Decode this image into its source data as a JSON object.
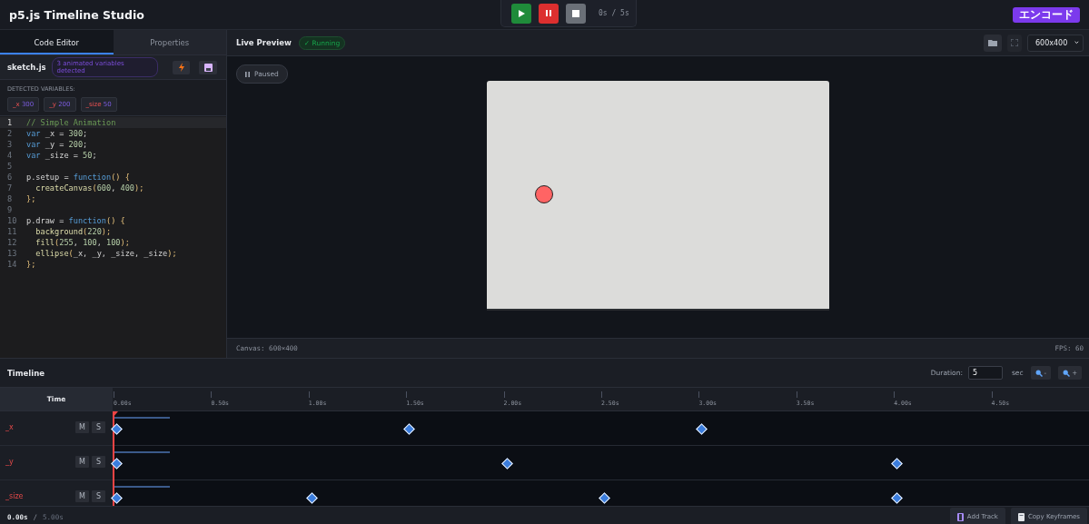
{
  "app": {
    "title": "p5.js Timeline Studio",
    "encode_button": "エンコード"
  },
  "transport": {
    "time": "0s / 5s"
  },
  "editor": {
    "tabs": [
      {
        "label": "Code Editor",
        "selected": true
      },
      {
        "label": "Properties",
        "selected": false
      }
    ],
    "file": "sketch.js",
    "badge": "3 animated variables detected",
    "variables_heading": "DETECTED VARIABLES:",
    "variables": [
      {
        "name": "_x",
        "value": "300"
      },
      {
        "name": "_y",
        "value": "200"
      },
      {
        "name": "_size",
        "value": "50"
      }
    ],
    "lines": [
      {
        "n": "1",
        "active": true,
        "tokens": [
          {
            "text": "// Simple Animation",
            "kind": "comment"
          }
        ]
      },
      {
        "n": "2",
        "active": false,
        "tokens": [
          {
            "text": "var",
            "kind": "keyword"
          },
          {
            "text": " _x = ",
            "kind": "plain"
          },
          {
            "text": "300",
            "kind": "number"
          },
          {
            "text": ";",
            "kind": "plain"
          }
        ]
      },
      {
        "n": "3",
        "active": false,
        "tokens": [
          {
            "text": "var",
            "kind": "keyword"
          },
          {
            "text": " _y = ",
            "kind": "plain"
          },
          {
            "text": "200",
            "kind": "number"
          },
          {
            "text": ";",
            "kind": "plain"
          }
        ]
      },
      {
        "n": "4",
        "active": false,
        "tokens": [
          {
            "text": "var",
            "kind": "keyword"
          },
          {
            "text": " _size = ",
            "kind": "plain"
          },
          {
            "text": "50",
            "kind": "number"
          },
          {
            "text": ";",
            "kind": "plain"
          }
        ]
      },
      {
        "n": "5",
        "active": false
      },
      {
        "n": "6",
        "active": false,
        "tokens": [
          {
            "text": "p.setup = ",
            "kind": "plain"
          },
          {
            "text": "function",
            "kind": "keyword"
          },
          {
            "text": "() {",
            "kind": "paren"
          }
        ]
      },
      {
        "n": "7",
        "active": false,
        "tokens": [
          {
            "text": "  createCanvas",
            "kind": "function"
          },
          {
            "text": "(",
            "kind": "paren"
          },
          {
            "text": "600",
            "kind": "number"
          },
          {
            "text": ", ",
            "kind": "plain"
          },
          {
            "text": "400",
            "kind": "number"
          },
          {
            "text": ");",
            "kind": "paren"
          }
        ]
      },
      {
        "n": "8",
        "active": false,
        "tokens": [
          {
            "text": "};",
            "kind": "paren"
          }
        ]
      },
      {
        "n": "9",
        "active": false
      },
      {
        "n": "10",
        "active": false,
        "tokens": [
          {
            "text": "p.draw = ",
            "kind": "plain"
          },
          {
            "text": "function",
            "kind": "keyword"
          },
          {
            "text": "() {",
            "kind": "paren"
          }
        ]
      },
      {
        "n": "11",
        "active": false,
        "tokens": [
          {
            "text": "  background",
            "kind": "function"
          },
          {
            "text": "(",
            "kind": "paren"
          },
          {
            "text": "220",
            "kind": "number"
          },
          {
            "text": ");",
            "kind": "paren"
          }
        ]
      },
      {
        "n": "12",
        "active": false,
        "tokens": [
          {
            "text": "  fill",
            "kind": "function"
          },
          {
            "text": "(",
            "kind": "paren"
          },
          {
            "text": "255",
            "kind": "number"
          },
          {
            "text": ", ",
            "kind": "plain"
          },
          {
            "text": "100",
            "kind": "number"
          },
          {
            "text": ", ",
            "kind": "plain"
          },
          {
            "text": "100",
            "kind": "number"
          },
          {
            "text": ");",
            "kind": "paren"
          }
        ]
      },
      {
        "n": "13",
        "active": false,
        "tokens": [
          {
            "text": "  ellipse",
            "kind": "function"
          },
          {
            "text": "(",
            "kind": "paren"
          },
          {
            "text": "_x, _y, _size, _size",
            "kind": "plain"
          },
          {
            "text": ");",
            "kind": "paren"
          }
        ]
      },
      {
        "n": "14",
        "active": false,
        "tokens": [
          {
            "text": "};",
            "kind": "paren"
          }
        ]
      }
    ]
  },
  "preview": {
    "title": "Live Preview",
    "status": "✓ Running",
    "size_select": "600x400",
    "paused_label": "Paused",
    "canvas_info": "Canvas: 600×400",
    "fps": "FPS: 60"
  },
  "timeline": {
    "title": "Timeline",
    "duration_label": "Duration:",
    "duration": "5",
    "duration_unit": "sec",
    "zoom_out": "-",
    "zoom_in": "+",
    "time_header": "Time",
    "ruler": [
      "0.00s",
      "0.50s",
      "1.00s",
      "1.50s",
      "2.00s",
      "2.50s",
      "3.00s",
      "3.50s",
      "4.00s",
      "4.50s"
    ],
    "tracks": [
      {
        "name": "_x",
        "mute": "M",
        "solo": "S",
        "keyframes": [
          {
            "level": 0
          },
          {
            "level": 0.3
          },
          {
            "level": 0.6
          }
        ]
      },
      {
        "name": "_y",
        "mute": "M",
        "solo": "S",
        "keyframes": [
          {
            "level": 0
          },
          {
            "level": 0.4
          },
          {
            "level": 0.8
          }
        ]
      },
      {
        "name": "_size",
        "mute": "M",
        "solo": "S",
        "keyframes": [
          {
            "level": 0
          },
          {
            "level": 0.2
          },
          {
            "level": 0.5
          },
          {
            "level": 0.8
          }
        ]
      }
    ],
    "current_time": "0.00s",
    "separator": "/",
    "total_time": "5.00s",
    "add_track": "Add Track",
    "copy_keyframes": "Copy Keyframes"
  }
}
